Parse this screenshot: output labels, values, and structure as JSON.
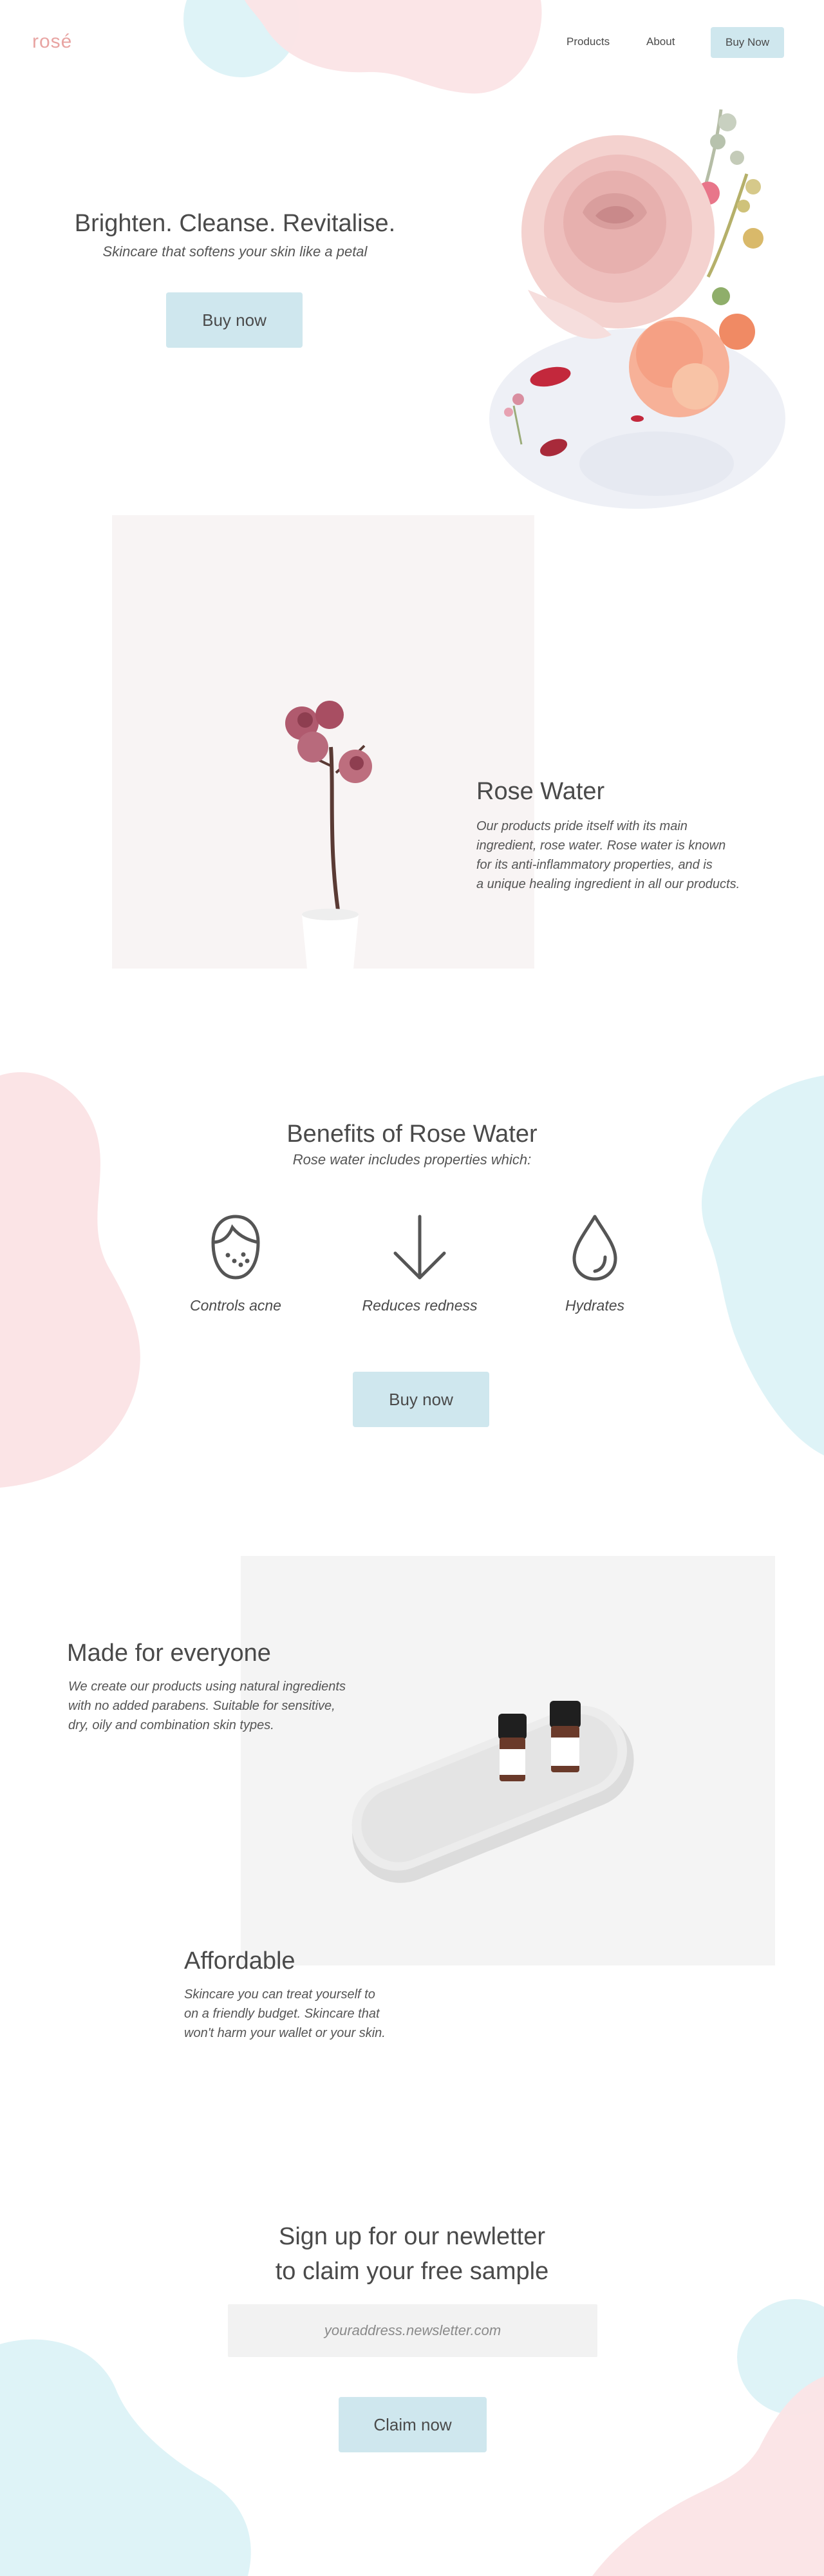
{
  "nav": {
    "logo": "rosé",
    "links": [
      "Products",
      "About"
    ],
    "cta": "Buy Now"
  },
  "hero": {
    "title": "Brighten. Cleanse. Revitalise.",
    "subtitle": "Skincare that softens your skin like a petal",
    "button": "Buy now"
  },
  "rose_water": {
    "title": "Rose Water",
    "body": "Our products pride itself with its main\ningredient, rose water. Rose water is known\nfor its anti-inflammatory properties, and is\na unique healing ingredient in all our products."
  },
  "benefits": {
    "title": "Benefits of Rose Water",
    "subtitle": "Rose water includes properties which:",
    "items": [
      {
        "icon": "face-icon",
        "label": "Controls acne"
      },
      {
        "icon": "arrow-down-icon",
        "label": "Reduces redness"
      },
      {
        "icon": "droplet-icon",
        "label": "Hydrates"
      }
    ],
    "button": "Buy now"
  },
  "made_for_everyone": {
    "title": "Made for everyone",
    "body": "We create our products using natural ingredients\nwith no added parabens. Suitable for sensitive,\ndry, oily and combination skin types."
  },
  "affordable": {
    "title": "Affordable",
    "body": "Skincare you can treat yourself to\non a friendly budget. Skincare that\nwon't harm your wallet or your skin."
  },
  "newsletter": {
    "title": "Sign up for our newletter\nto claim your free sample",
    "placeholder": "youraddress.newsletter.com",
    "button": "Claim now"
  },
  "colors": {
    "accent_blue": "#cfe7ee",
    "blob_blue": "#def3f7",
    "blob_pink": "#fbe4e6",
    "logo_pink": "#e8a4a2",
    "text": "#4a4a4a"
  }
}
